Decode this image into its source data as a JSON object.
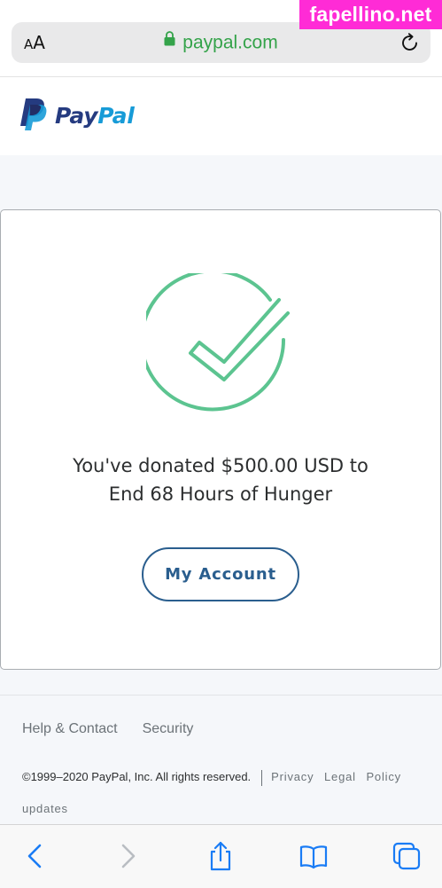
{
  "browser": {
    "text_size_label_small": "A",
    "text_size_label_big": "A",
    "url": "paypal.com",
    "colors": {
      "url_green": "#34a34a",
      "bar_bg": "#e9e9ea"
    },
    "icons": [
      "lock-icon",
      "reload-icon"
    ]
  },
  "watermark": {
    "text": "fapellino.net",
    "color": "#ff2bd6"
  },
  "header": {
    "logo_text_pay": "Pay",
    "logo_text_pal": "Pal",
    "colors": {
      "pay": "#253b80",
      "pal": "#179bd7"
    }
  },
  "confirmation": {
    "message_line1": "You've donated $500.00 USD to",
    "message_line2": "End 68 Hours of Hunger",
    "button_label": "My Account",
    "check_color": "#5cc490",
    "button_color": "#2a5e8e"
  },
  "footer": {
    "links": [
      "Help & Contact",
      "Security"
    ],
    "copyright": "©1999–2020  PayPal, Inc. All rights reserved.",
    "legal_links": [
      "Privacy",
      "Legal",
      "Policy"
    ],
    "updates": "updates"
  },
  "toolbar": {
    "icons": [
      "back-icon",
      "forward-icon",
      "share-icon",
      "bookmarks-icon",
      "tabs-icon"
    ]
  }
}
